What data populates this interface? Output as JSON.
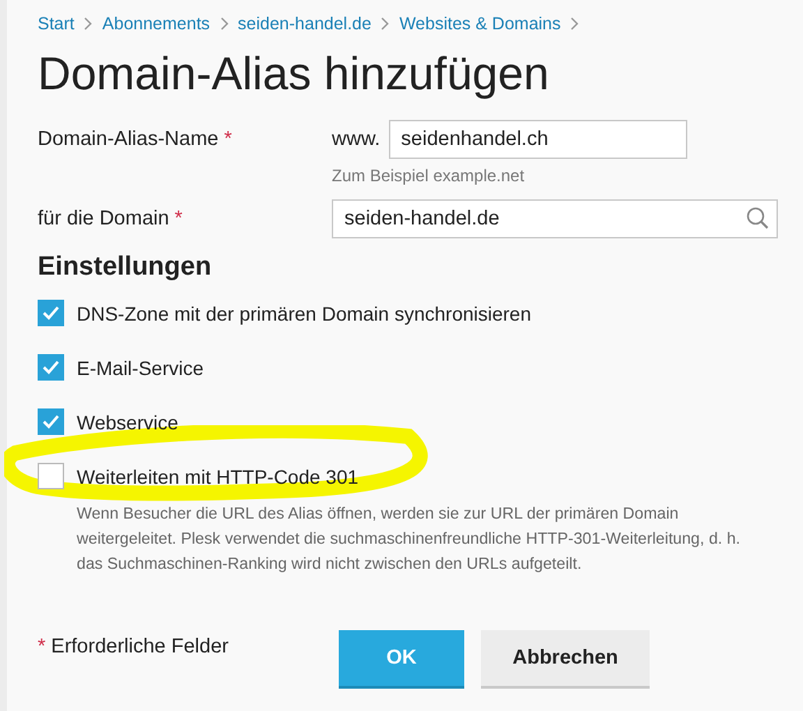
{
  "breadcrumb": [
    "Start",
    "Abonnements",
    "seiden-handel.de",
    "Websites & Domains"
  ],
  "title": "Domain-Alias hinzufügen",
  "required_mark": "*",
  "alias_field": {
    "label": "Domain-Alias-Name",
    "required": true,
    "prefix": "www.",
    "value": "seidenhandel.ch",
    "hint": "Zum Beispiel example.net"
  },
  "domain_field": {
    "label": "für die Domain",
    "required": true,
    "value": "seiden-handel.de"
  },
  "section_title": "Einstellungen",
  "options": [
    {
      "label": "DNS-Zone mit der primären Domain synchronisieren",
      "checked": true,
      "highlighted": false
    },
    {
      "label": "E-Mail-Service",
      "checked": true,
      "highlighted": false
    },
    {
      "label": "Webservice",
      "checked": true,
      "highlighted": false
    },
    {
      "label": "Weiterleiten mit HTTP-Code 301",
      "checked": false,
      "highlighted": true,
      "description": "Wenn Besucher die URL des Alias öffnen, werden sie zur URL der primären Domain weitergeleitet. Plesk verwendet die suchmaschinenfreundliche HTTP-301-Weiterleitung, d. h. das Suchmaschinen-Ranking wird nicht zwischen den URLs aufgeteilt."
    }
  ],
  "required_note": "Erforderliche Felder",
  "buttons": [
    {
      "label": "OK",
      "kind": "primary"
    },
    {
      "label": "Abbrechen",
      "kind": "secondary"
    }
  ]
}
